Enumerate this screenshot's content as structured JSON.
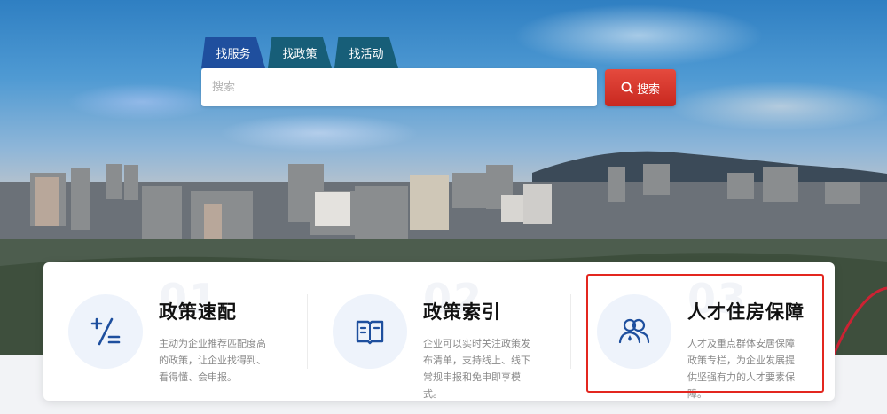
{
  "tabs": [
    {
      "label": "找服务",
      "active": true
    },
    {
      "label": "找政策",
      "active": false
    },
    {
      "label": "找活动",
      "active": false
    }
  ],
  "search": {
    "placeholder": "搜索",
    "button_label": "搜索",
    "button_icon": "search-icon"
  },
  "cards": [
    {
      "num": "01",
      "title": "政策速配",
      "desc": "主动为企业推荐匹配度高的政策，让企业找得到、看得懂、会申报。",
      "icon": "plus-minus-equals-icon"
    },
    {
      "num": "02",
      "title": "政策索引",
      "desc": "企业可以实时关注政策发布清单，支持线上、线下常规申报和免申即享模式。",
      "icon": "open-book-icon"
    },
    {
      "num": "03",
      "title": "人才住房保障",
      "desc": "人才及重点群体安居保障政策专栏，为企业发展提供坚强有力的人才要素保障。",
      "icon": "people-icon"
    }
  ],
  "colors": {
    "accent_blue": "#1f4f9e",
    "search_red": "#e3261f",
    "highlight_border": "#e3261f",
    "icon_blue": "#1e4f9e"
  }
}
